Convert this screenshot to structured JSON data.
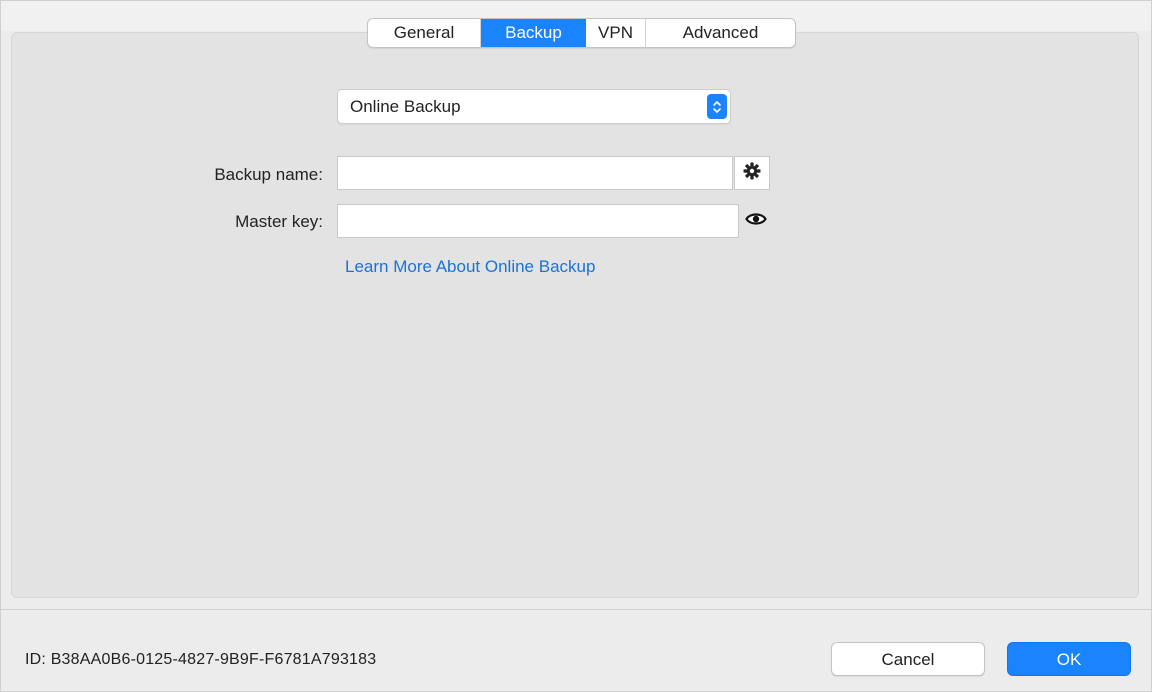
{
  "tabs": [
    {
      "label": "General",
      "selected": false
    },
    {
      "label": "Backup",
      "selected": true
    },
    {
      "label": "VPN",
      "selected": false
    },
    {
      "label": "Advanced",
      "selected": false
    }
  ],
  "backup": {
    "type_selected": "Online Backup",
    "name_label": "Backup name:",
    "name_value": "",
    "key_label": "Master key:",
    "key_value": "",
    "learn_more": "Learn More About Online Backup"
  },
  "footer": {
    "id_text": "ID:  B38AA0B6-0125-4827-9B9F-F6781A793183",
    "cancel_label": "Cancel",
    "ok_label": "OK"
  },
  "colors": {
    "accent": "#1a84ff",
    "link": "#1a73d9",
    "panel": "#e3e3e3"
  },
  "icons": {
    "select_arrows": "chevron-up-down-icon",
    "name_action": "gear-icon",
    "key_action": "eye-icon"
  }
}
